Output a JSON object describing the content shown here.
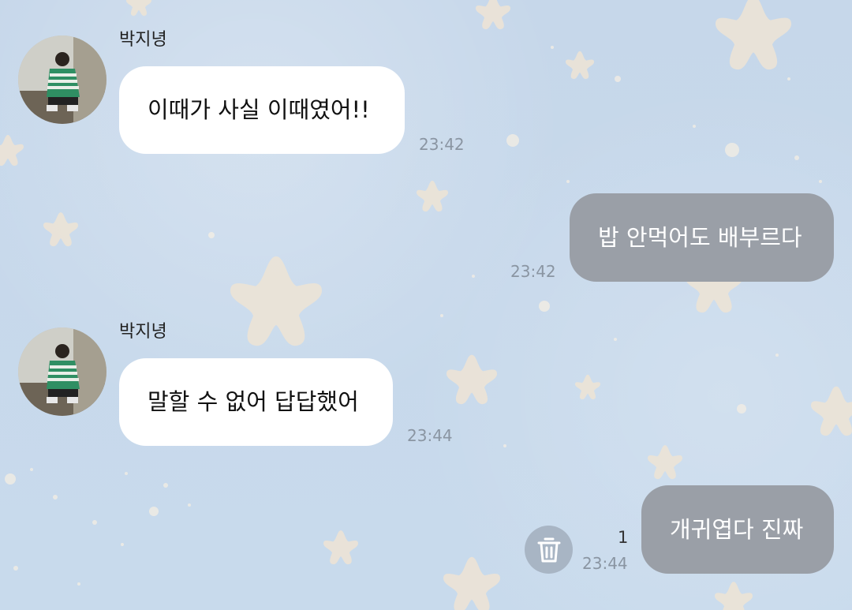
{
  "chat": {
    "messages": [
      {
        "direction": "incoming",
        "sender": "박지녕",
        "text": "이때가 사실 이때였어!!",
        "time": "23:42",
        "avatar_icon": "profile-photo"
      },
      {
        "direction": "outgoing",
        "text": "밥 안먹어도 배부르다",
        "time": "23:42"
      },
      {
        "direction": "incoming",
        "sender": "박지녕",
        "text": "말할 수 없어 답답했어",
        "time": "23:44",
        "avatar_icon": "profile-photo"
      },
      {
        "direction": "outgoing",
        "text": "개귀엽다 진짜",
        "time": "23:44",
        "unread_count": "1",
        "action_icon": "trash-icon"
      }
    ]
  },
  "colors": {
    "background": "#c7d8ea",
    "incoming_bubble": "#ffffff",
    "outgoing_bubble": "#9a9fa7",
    "timestamp": "#8a95a2",
    "trash_button": "#a8b5c4"
  }
}
